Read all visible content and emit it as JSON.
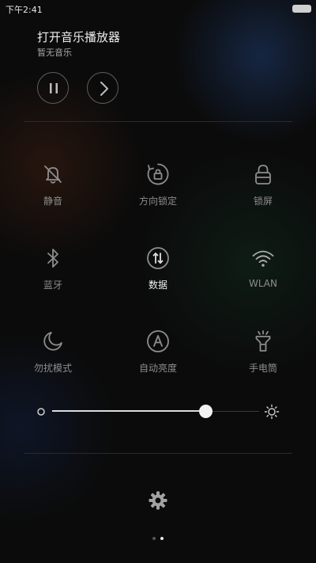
{
  "status_bar": {
    "time": "下午2:41"
  },
  "music": {
    "title": "打开音乐播放器",
    "subtitle": "暂无音乐",
    "pause_icon": "pause-icon",
    "next_icon": "chevron-right-icon"
  },
  "toggles": [
    {
      "label": "静音",
      "icon": "bell-off-icon",
      "active": false
    },
    {
      "label": "方向锁定",
      "icon": "rotation-lock-icon",
      "active": false
    },
    {
      "label": "锁屏",
      "icon": "lock-icon",
      "active": false
    },
    {
      "label": "蓝牙",
      "icon": "bluetooth-icon",
      "active": false
    },
    {
      "label": "数据",
      "icon": "mobile-data-icon",
      "active": true
    },
    {
      "label": "WLAN",
      "icon": "wifi-icon",
      "active": false
    },
    {
      "label": "勿扰模式",
      "icon": "moon-icon",
      "active": false
    },
    {
      "label": "自动亮度",
      "icon": "auto-brightness-icon",
      "active": false
    },
    {
      "label": "手电筒",
      "icon": "flashlight-icon",
      "active": false
    }
  ],
  "brightness": {
    "value": 0.74,
    "low_icon": "brightness-low-icon",
    "high_icon": "brightness-high-icon"
  },
  "settings_icon": "gear-icon",
  "pager": {
    "count": 2,
    "current": 2
  },
  "colors": {
    "icon_inactive": "#8d8d8d",
    "icon_active": "#f0f0f0",
    "accent_wifi": "#a9a9a9"
  }
}
